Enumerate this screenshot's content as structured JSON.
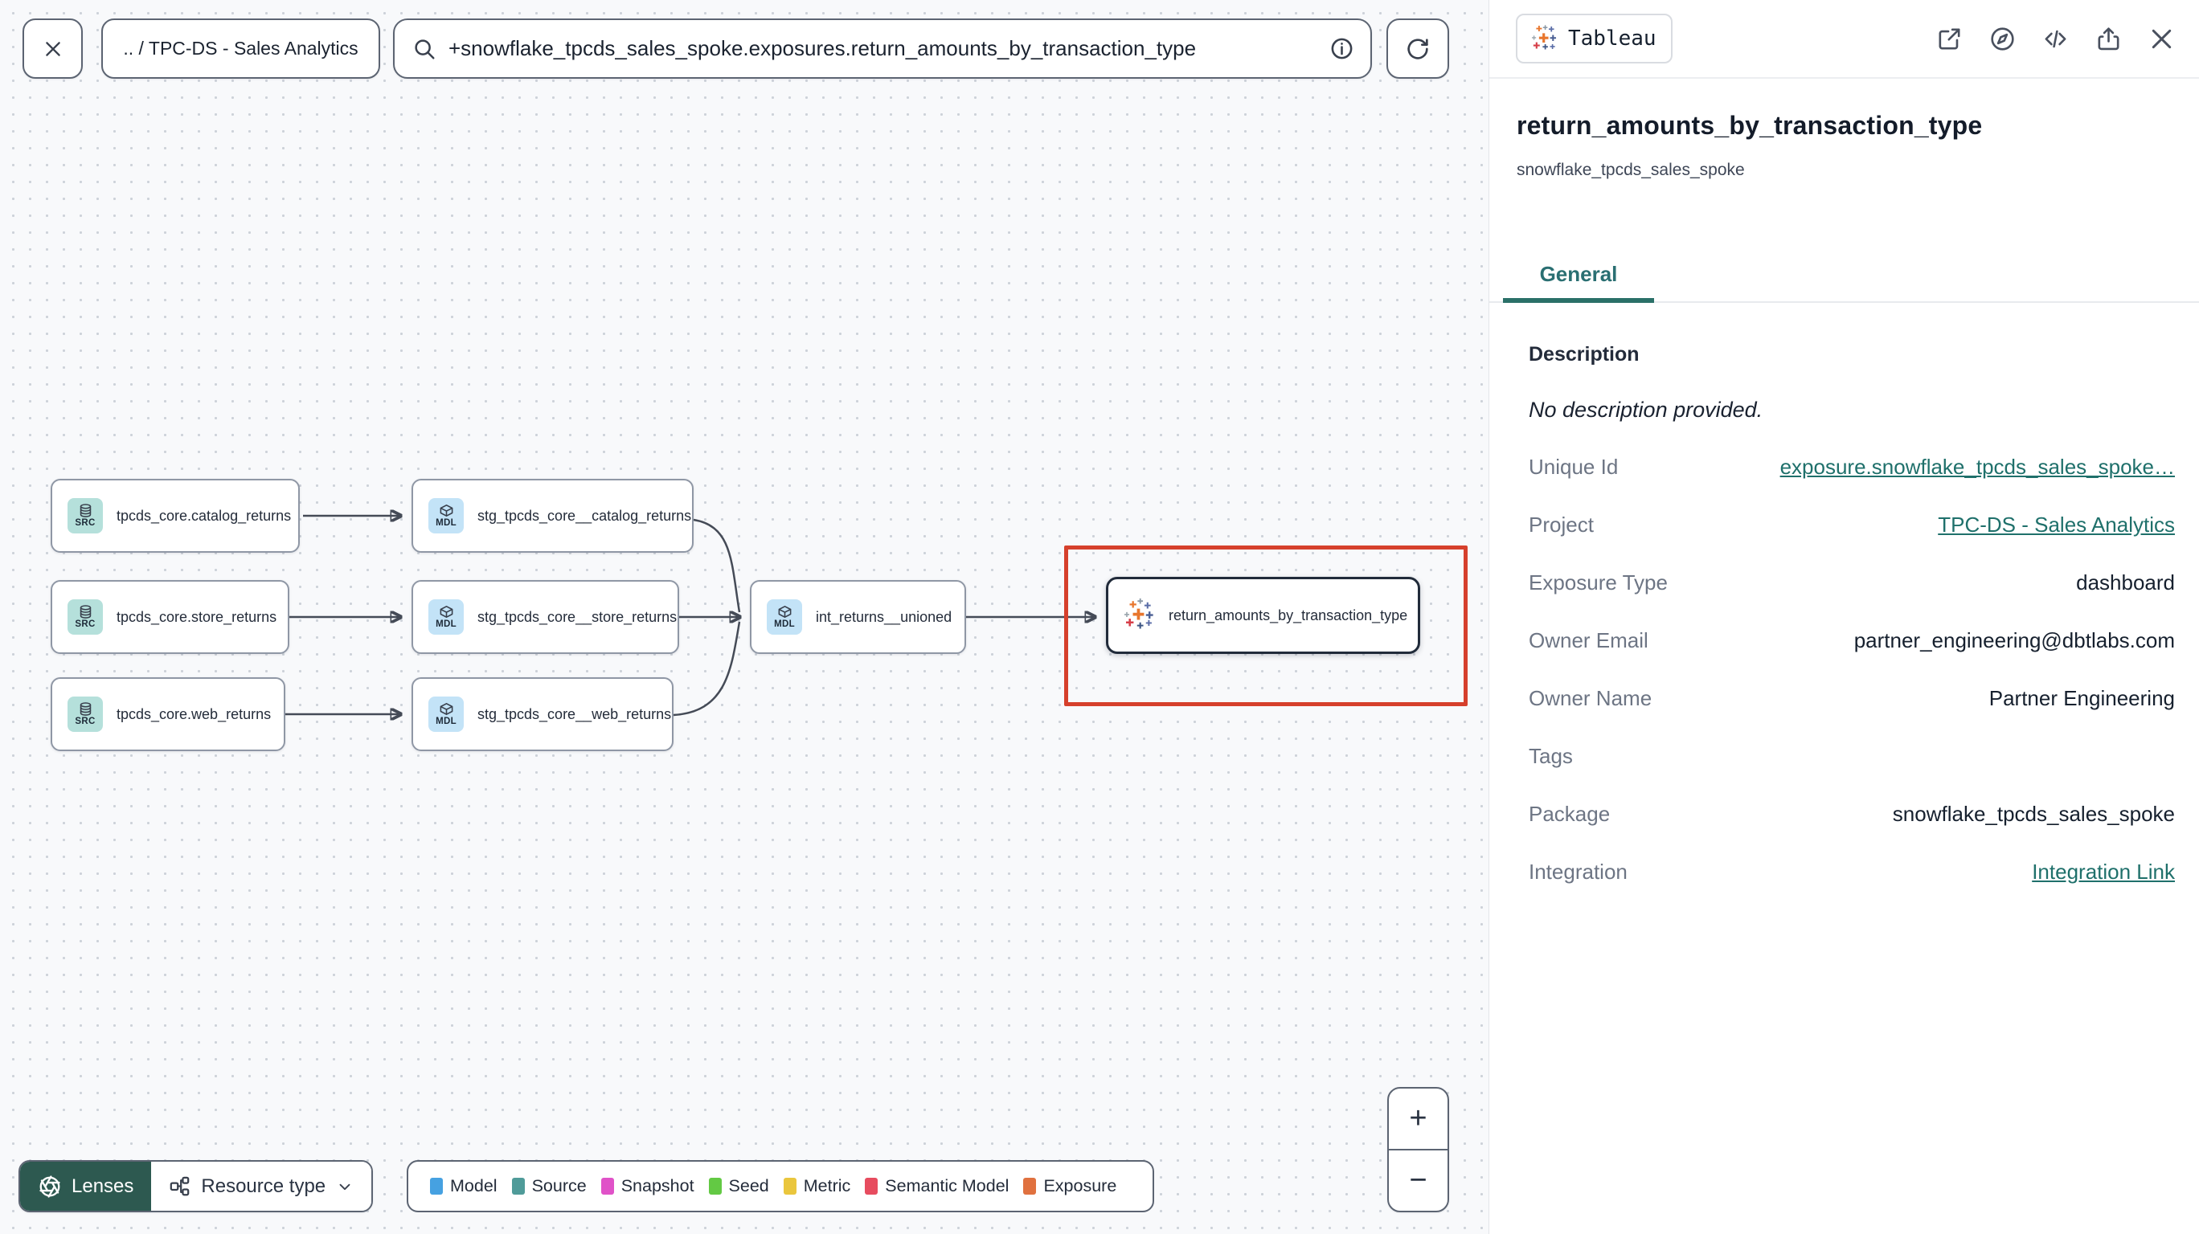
{
  "topbar": {
    "breadcrumb": ".. / TPC-DS - Sales Analytics",
    "search_value": "+snowflake_tpcds_sales_spoke.exposures.return_amounts_by_transaction_type"
  },
  "canvas": {
    "nodes": [
      {
        "badge": "SRC",
        "label": "tpcds_core.catalog_returns"
      },
      {
        "badge": "SRC",
        "label": "tpcds_core.store_returns"
      },
      {
        "badge": "SRC",
        "label": "tpcds_core.web_returns"
      },
      {
        "badge": "MDL",
        "label": "stg_tpcds_core__catalog_returns"
      },
      {
        "badge": "MDL",
        "label": "stg_tpcds_core__store_returns"
      },
      {
        "badge": "MDL",
        "label": "stg_tpcds_core__web_returns"
      },
      {
        "badge": "MDL",
        "label": "int_returns__unioned"
      },
      {
        "label": "return_amounts_by_transaction_type"
      }
    ],
    "lenses_label": "Lenses",
    "resource_type_label": "Resource type",
    "zoom_in": "+",
    "zoom_out": "−",
    "legend": [
      {
        "label": "Model",
        "color": "#46a1e1"
      },
      {
        "label": "Source",
        "color": "#4f9b99"
      },
      {
        "label": "Snapshot",
        "color": "#e052c8"
      },
      {
        "label": "Seed",
        "color": "#63c944"
      },
      {
        "label": "Metric",
        "color": "#eac63d"
      },
      {
        "label": "Semantic Model",
        "color": "#e74c5f"
      },
      {
        "label": "Exposure",
        "color": "#e0713f"
      }
    ]
  },
  "panel": {
    "integration_badge": "Tableau",
    "title": "return_amounts_by_transaction_type",
    "subtitle": "snowflake_tpcds_sales_spoke",
    "tab": "General",
    "description_heading": "Description",
    "description_empty": "No description provided.",
    "rows": [
      {
        "label": "Unique Id",
        "value": "exposure.snowflake_tpcds_sales_spoke…"
      },
      {
        "label": "Project",
        "value": "TPC-DS - Sales Analytics"
      },
      {
        "label": "Exposure Type",
        "value": "dashboard"
      },
      {
        "label": "Owner Email",
        "value": "partner_engineering@dbtlabs.com"
      },
      {
        "label": "Owner Name",
        "value": "Partner Engineering"
      },
      {
        "label": "Tags",
        "value": ""
      },
      {
        "label": "Package",
        "value": "snowflake_tpcds_sales_spoke"
      },
      {
        "label": "Integration",
        "value": "Integration Link"
      }
    ]
  },
  "colors": {
    "accent_teal": "#1f706b",
    "highlight_red": "#d6402c",
    "lenses_green": "#2d5950",
    "selected_node_border": "#212b3a"
  }
}
